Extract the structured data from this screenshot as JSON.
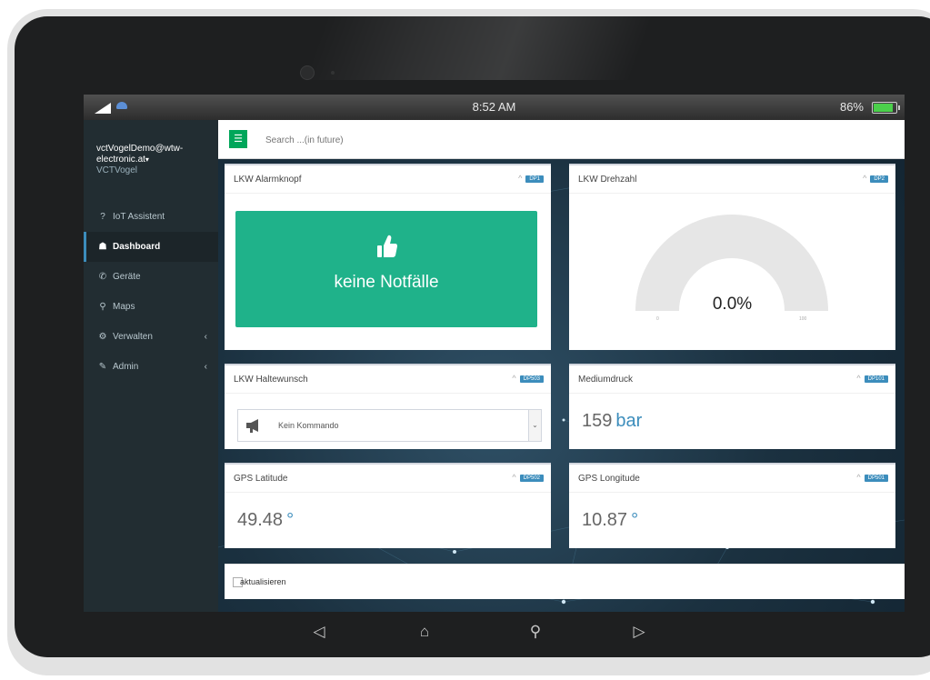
{
  "status_bar": {
    "time": "8:52 AM",
    "battery_percent": "86%",
    "battery_level": 0.86
  },
  "sidebar": {
    "user_email": "vctVogelDemo@wtw-electronic.at",
    "user_name": "VCTVogel",
    "items": [
      {
        "label": "IoT Assistent",
        "icon": "question-icon"
      },
      {
        "label": "Dashboard",
        "icon": "dashboard-icon",
        "active": true
      },
      {
        "label": "Geräte",
        "icon": "devices-icon"
      },
      {
        "label": "Maps",
        "icon": "map-pin-icon"
      },
      {
        "label": "Verwalten",
        "icon": "cogs-icon"
      },
      {
        "label": "Admin",
        "icon": "wrench-icon"
      }
    ]
  },
  "topbar": {
    "search_placeholder": "Search ...(in future)"
  },
  "cards": {
    "alarm": {
      "title": "LKW Alarmknopf",
      "dp": "DP1",
      "status_text": "keine Notfälle",
      "icon": "thumbs-up-icon"
    },
    "rpm": {
      "title": "LKW Drehzahl",
      "dp": "DP2",
      "value": "0.0%",
      "gauge_fraction": 0.0,
      "min_label": "0",
      "max_label": "100"
    },
    "stop_request": {
      "title": "LKW Haltewunsch",
      "dp": "DP503",
      "selected": "Kein Kommando",
      "icon": "megaphone-icon"
    },
    "medium_pressure": {
      "title": "Mediumdruck",
      "dp": "DP101",
      "value": "159",
      "unit": "bar"
    },
    "gps_lat": {
      "title": "GPS Latitude",
      "dp": "DP502",
      "value": "49.48",
      "unit": "°"
    },
    "gps_lon": {
      "title": "GPS Longitude",
      "dp": "DP501",
      "value": "10.87",
      "unit": "°"
    }
  },
  "footer": {
    "refresh_label": "aktualisieren",
    "refresh_checked": false
  },
  "android_nav": {
    "back": "◁",
    "home": "⌂",
    "search": "⚲",
    "recents": "▷"
  },
  "colors": {
    "accent_green": "#1fb28a",
    "menu_green": "#00a65a",
    "label_blue": "#3c8dbc",
    "sidebar": "#222d32"
  }
}
